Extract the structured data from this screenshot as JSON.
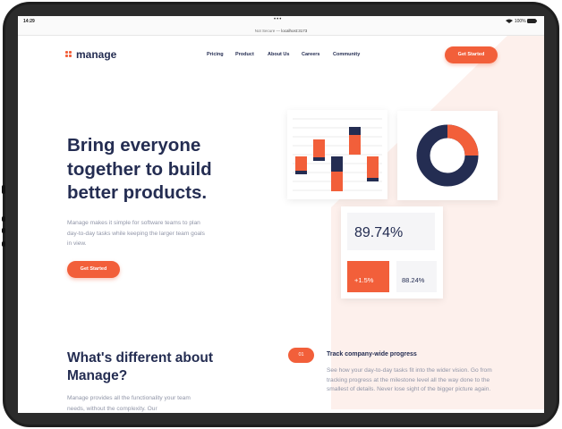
{
  "status_bar": {
    "time": "14:29",
    "dots": "•••",
    "battery": "100%"
  },
  "url_bar": {
    "prefix": "Not Secure — ",
    "host": "localhost:3173"
  },
  "logo": {
    "text": "manage"
  },
  "nav": {
    "items": [
      "Pricing",
      "Product",
      "About Us",
      "Careers",
      "Community"
    ],
    "cta": "Get Started"
  },
  "hero": {
    "title": "Bring everyone together to build better products.",
    "text": "Manage makes it simple for software teams to plan day-to-day tasks while keeping the larger team goals in view.",
    "cta": "Get Started"
  },
  "stats": {
    "main": "89.74%",
    "change": "+1.5%",
    "secondary": "88.24%"
  },
  "section": {
    "title": "What's different about Manage?",
    "text": "Manage provides all the functionality your team needs, without the complexity. Our"
  },
  "feature": {
    "number": "01",
    "title": "Track company-wide progress",
    "text": "See how your day-to-day tasks fit into the wider vision. Go from tracking progress at the milestone level all the way done to the smallest of details. Never lose sight of the bigger picture again."
  },
  "colors": {
    "accent": "#f25f3a",
    "navy": "#242d52",
    "muted": "#9095a7",
    "bg_shape": "#fdf0ec"
  }
}
